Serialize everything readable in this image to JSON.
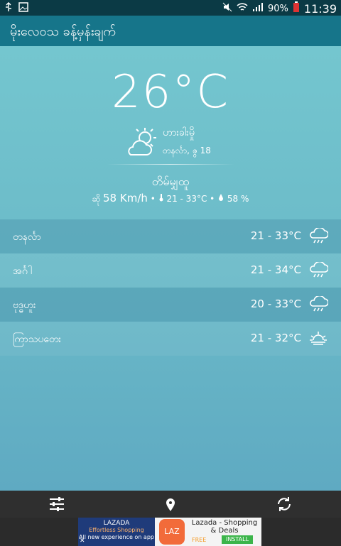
{
  "status": {
    "battery": "90%",
    "time": "11:39"
  },
  "appbar": {
    "title": "မိုးလေဝသ ခန့်မှန်းချက်"
  },
  "current": {
    "temperature": "26°C",
    "condition": "ဟားခါးမှို",
    "date": "တနင်္လာ, ဇွ 18",
    "day": "တိမ်မျှထူ",
    "wind": "58 Km/h",
    "temp_range": "21 - 33°C",
    "humidity": "58 %",
    "wind_prefix": "ဆို",
    "sep1": "•",
    "sep2": "•"
  },
  "forecast": [
    {
      "day": "တနင်္လာ",
      "range": "21 - 33°C",
      "icon": "rain-cloud-icon"
    },
    {
      "day": "အင်္ဂါ",
      "range": "21 - 34°C",
      "icon": "rain-cloud-icon"
    },
    {
      "day": "ဗုဒ္ဓဟူး",
      "range": "20 - 33°C",
      "icon": "rain-cloud-icon"
    },
    {
      "day": "ကြာသပတေး",
      "range": "21 - 32°C",
      "icon": "sunrise-icon"
    }
  ],
  "ad": {
    "banner_brand": "LAZADA",
    "banner_sub": "Effortless Shopping",
    "banner_text": "All new experience on app",
    "logo": "LAZ",
    "app_title": "Lazada - Shopping & Deals",
    "price": "FREE",
    "install": "INSTALL"
  },
  "colors": {
    "statusbar": "#0b3a45",
    "appbar": "#16758a",
    "bottombar": "#2f2f2f"
  }
}
